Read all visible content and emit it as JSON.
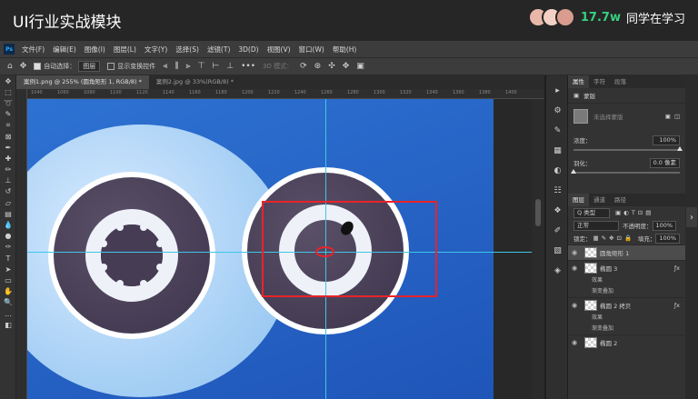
{
  "banner": {
    "title": "UI行业实战模块",
    "viewer_count": "17.7w",
    "viewer_text": "同学在学习"
  },
  "app": {
    "logo": "Ps"
  },
  "menu": [
    "文件(F)",
    "编辑(E)",
    "图像(I)",
    "图层(L)",
    "文字(Y)",
    "选择(S)",
    "滤镜(T)",
    "3D(D)",
    "视图(V)",
    "窗口(W)",
    "帮助(H)"
  ],
  "options": {
    "auto_select_label": "自动选择：",
    "auto_select_value": "图层",
    "show_transform_label": "显示变换控件",
    "mode_label": "3D 模式："
  },
  "tabs": [
    {
      "label": "案例1.png @ 255% (圆角矩形 1, RGB/8) *",
      "active": true
    },
    {
      "label": "案例2.jpg @ 33%(RGB/8) *",
      "active": false
    }
  ],
  "ruler_ticks": [
    "1040",
    "1060",
    "1080",
    "1100",
    "1120",
    "1140",
    "1160",
    "1180",
    "1200",
    "1220",
    "1240",
    "1260",
    "1280",
    "1300",
    "1320",
    "1340",
    "1360",
    "1380",
    "1400"
  ],
  "properties": {
    "tabs": [
      "属性",
      "字符",
      "段落"
    ],
    "type_label": "蒙版",
    "mask_label": "未选择蒙版",
    "density_label": "浓度：",
    "density_value": "100%",
    "feather_label": "羽化：",
    "feather_value": "0.0 像素"
  },
  "layers_panel": {
    "tabs": [
      "图层",
      "通道",
      "路径"
    ],
    "filter_label": "Q 类型",
    "blend_mode": "正常",
    "opacity_label": "不透明度：",
    "opacity_value": "100%",
    "lock_label": "锁定：",
    "fill_label": "填充：",
    "fill_value": "100%",
    "layers": [
      {
        "name": "圆角矩形 1",
        "active": true,
        "fx": false
      },
      {
        "name": "椭圆 3",
        "active": false,
        "fx": true
      },
      {
        "name": "效果",
        "sub": true
      },
      {
        "name": "渐变叠加",
        "sub": true
      },
      {
        "name": "椭圆 2 拷贝",
        "active": false,
        "fx": true
      },
      {
        "name": "效果",
        "sub": true
      },
      {
        "name": "渐变叠加",
        "sub": true
      },
      {
        "name": "椭圆 2",
        "active": false,
        "fx": false
      }
    ]
  }
}
